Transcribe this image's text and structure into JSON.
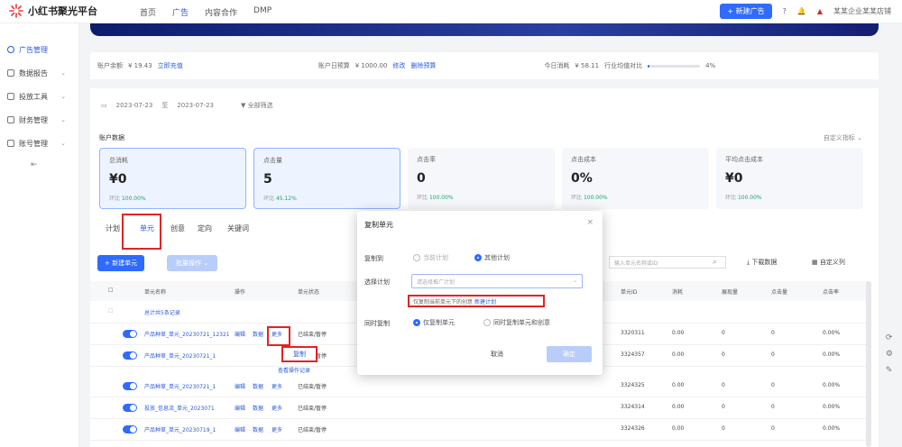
{
  "app": {
    "title": "小红书聚光平台"
  },
  "nav": {
    "items": [
      "首页",
      "广告",
      "内容合作",
      "DMP"
    ]
  },
  "topbar": {
    "create_ad_label": "+ 新建广告",
    "user_text": "某某企业某某店铺"
  },
  "sidebar": {
    "items": [
      "广告管理",
      "数据报告",
      "投放工具",
      "财务管理",
      "账号管理"
    ]
  },
  "stats": {
    "account_balance_label": "账户余额",
    "account_balance_value": "¥ 19.43",
    "account_balance_link": "立即充值",
    "account_budget_label": "账户日预算",
    "account_budget_value": "¥ 1000.00",
    "account_budget_link1": "修改",
    "account_budget_link2": "删除预算",
    "today_spend_label": "今日消耗",
    "today_spend_value": "¥ 58.11",
    "today_spend_link": "行业均值对比",
    "today_spend_percent": "4%",
    "today_spend_fraction": 0.04
  },
  "filters": {
    "date_start": "2023-07-23",
    "date_sep": "至",
    "date_end": "2023-07-23",
    "filter_label": "▼ 全部筛选"
  },
  "overview": {
    "title": "账户数据",
    "custom_link": "自定义指标 ⌄",
    "cards": [
      {
        "label": "总消耗",
        "value": "¥0",
        "cmp_label": "环比",
        "cmp_value": "100.00%"
      },
      {
        "label": "点击量",
        "value": "5",
        "cmp_label": "环比",
        "cmp_value": "45.12%"
      },
      {
        "label": "点击率",
        "value": "0",
        "cmp_label": "环比",
        "cmp_value": "100.00%"
      },
      {
        "label": "点击成本",
        "value": "0%",
        "cmp_label": "环比",
        "cmp_value": "100.00%"
      },
      {
        "label": "平均点击成本",
        "value": "¥0",
        "cmp_label": "环比",
        "cmp_value": "100.00%"
      }
    ]
  },
  "tabs": {
    "items": [
      "计划",
      "单元",
      "创意",
      "定向",
      "关键词"
    ],
    "active_index": 1
  },
  "toolbar": {
    "new_unit": "+ 新建单元",
    "batch": "批量操作 ⌄",
    "search_placeholder": "输入单元名称或ID",
    "download": "下载数据",
    "custom_columns": "自定义列"
  },
  "table": {
    "headers": [
      "单元名称",
      "操作",
      "单元状态",
      "单元ID",
      "消耗",
      "展现量",
      "点击量",
      "点击率"
    ],
    "total_label": "总计共5条记录",
    "rows": [
      {
        "name": "产品种草_单元_20230721_12321",
        "ops": [
          "编辑",
          "数据",
          "更多"
        ],
        "status": "已结束/暂停",
        "unit_id": "3320311",
        "c1": "0.00",
        "c2": "0",
        "c3": "0",
        "c4": "0.00%"
      },
      {
        "name": "产品种草_单元_20230721_1",
        "ops": [
          "编辑",
          "数据",
          "更多"
        ],
        "status": "已结束/暂停",
        "unit_id": "3324357",
        "c1": "0.00",
        "c2": "0",
        "c3": "0",
        "c4": "0.00%"
      },
      {
        "name": "产品种草_单元_20230721_1",
        "ops": [
          "编辑",
          "数据",
          "更多"
        ],
        "status": "已结束/暂停",
        "unit_id": "3324325",
        "c1": "0.00",
        "c2": "0",
        "c3": "0",
        "c4": "0.00%"
      },
      {
        "name": "投放_信息流_单元_2023071",
        "ops": [
          "编辑",
          "数据",
          "更多"
        ],
        "status": "已结束/暂停",
        "unit_id": "3324314",
        "c1": "0.00",
        "c2": "0",
        "c3": "0",
        "c4": "0.00%"
      },
      {
        "name": "产品种草_单元_20230719_1",
        "ops": [
          "编辑",
          "数据",
          "更多"
        ],
        "status": "已结束/暂停",
        "unit_id": "3324326",
        "c1": "0.00",
        "c2": "0",
        "c3": "0",
        "c4": "0.00%"
      }
    ],
    "copy_label": "复制",
    "copy_sub": "查看操作记录"
  },
  "dialog": {
    "title": "复制单元",
    "close": "×",
    "copy_to_label": "复制到",
    "copy_to_opt1": "当前计划",
    "copy_to_opt2": "其他计划",
    "target_plan_label": "选择计划",
    "target_plan_placeholder": "请选择推广计划",
    "hint_text": "仅复制当前单元下的创意",
    "hint_link": "新建计划",
    "sync_label": "同时复制",
    "sync_opt1": "仅复制单元",
    "sync_opt2": "同时复制单元和创意",
    "cancel": "取消",
    "ok": "确定"
  },
  "colors": {
    "accent": "#2f6bff",
    "highlight": "#e02424",
    "band": "#1a2a8a"
  }
}
